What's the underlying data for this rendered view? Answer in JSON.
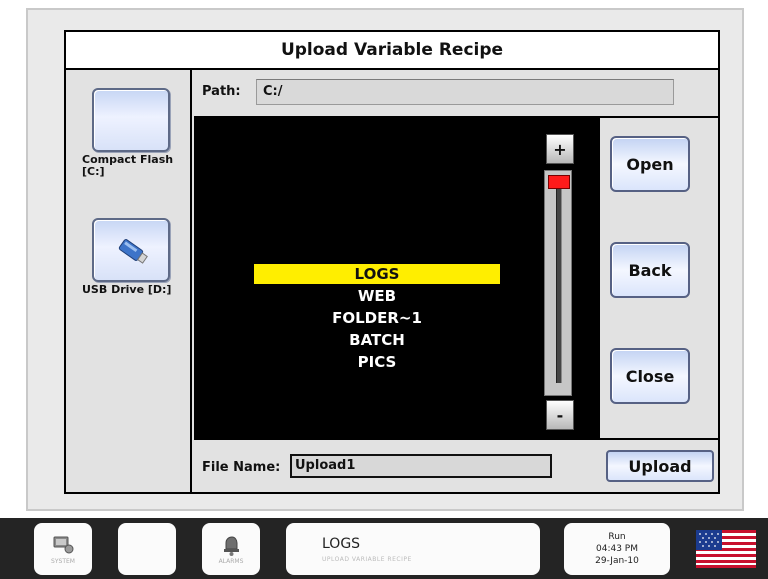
{
  "dialog": {
    "title": "Upload Variable Recipe",
    "path_label": "Path:",
    "path_value": "C:/",
    "file_name_label": "File Name:",
    "file_name_value": "Upload1"
  },
  "drives": [
    {
      "label": "Compact Flash [C:]",
      "icon": "compact-flash-icon"
    },
    {
      "label": "USB Drive [D:]",
      "icon": "usb-drive-icon"
    }
  ],
  "file_list": {
    "items": [
      "LOGS",
      "WEB",
      "FOLDER~1",
      "BATCH",
      "PICS"
    ],
    "selected_index": 0,
    "scroll_position": 0
  },
  "scrollbar": {
    "up_label": "+",
    "down_label": "-"
  },
  "actions": {
    "open": "Open",
    "back": "Back",
    "close": "Close",
    "upload": "Upload"
  },
  "taskbar": {
    "btn1_label": "SYSTEM",
    "btn3_label": "ALARMS",
    "status_main": "LOGS",
    "status_sub": "UPLOAD VARIABLE RECIPE",
    "clock_mode": "Run",
    "clock_time": "04:43 PM",
    "clock_date": "29-Jan-10"
  },
  "colors": {
    "selection": "#ffee00",
    "scroll_thumb": "#ff1a1a",
    "list_bg": "#000000"
  }
}
